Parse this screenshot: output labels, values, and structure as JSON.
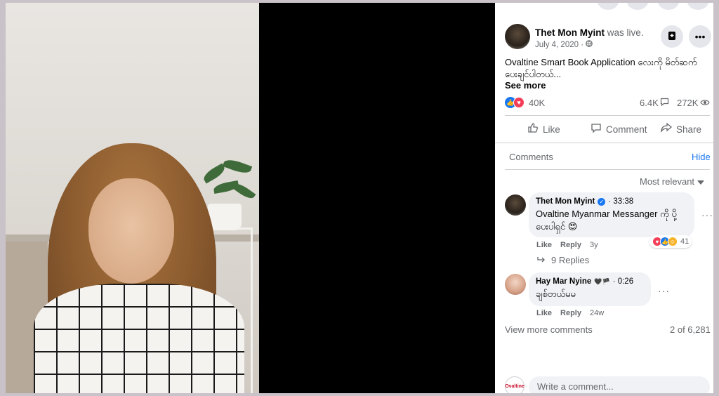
{
  "post": {
    "author": "Thet Mon Myint",
    "status": "was live.",
    "date": "July 4, 2020 ·",
    "text": "Ovaltine Smart Book Application လေးကို မိတ်ဆက်ပေးချင်ပါတယ်...",
    "see_more": "See more",
    "reactions": "40K",
    "comments_count": "6.4K",
    "views": "272K",
    "icons": {
      "globe": "globe-icon",
      "save": "bookmark-icon",
      "more": "more-options-icon"
    }
  },
  "actions": {
    "like": "Like",
    "comment": "Comment",
    "share": "Share"
  },
  "comments_section": {
    "label": "Comments",
    "hide": "Hide",
    "sort": "Most relevant",
    "items": [
      {
        "name": "Thet Mon Myint",
        "time": "33:38",
        "text": "Ovaltine Myanmar Messanger ကို ပို့ပေးပါရှင် 😍",
        "like": "Like",
        "reply": "Reply",
        "age": "3y",
        "reaction_count": "41",
        "replies": "9 Replies"
      },
      {
        "name": "Hay Mar Nyine",
        "badge": "🖤🏴",
        "time": "0:26",
        "text": "ချစ်တယ်မမ",
        "like": "Like",
        "reply": "Reply",
        "age": "24w"
      }
    ],
    "view_more": "View more comments",
    "count": "2 of 6,281",
    "write_placeholder": "Write a comment...",
    "user_logo_text": "Ovaltine"
  },
  "colors": {
    "accent": "#1877f2",
    "love": "#f33e58",
    "panel_bg": "#ffffff",
    "frame_bg": "#c9c2c9"
  }
}
